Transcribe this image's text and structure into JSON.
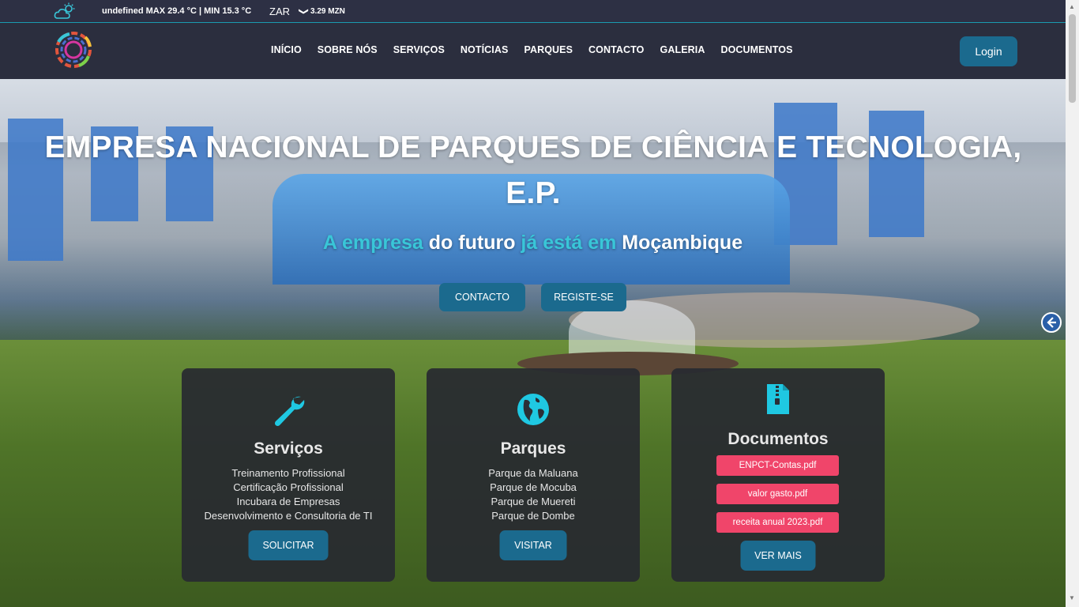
{
  "topbar": {
    "weather": "undefined MAX 29.4 °C | MIN 15.3 °C",
    "currency_code": "ZAR",
    "currency_chevron": "❯",
    "currency_rate": "3.29 MZN",
    "weather_icon": "cloud-sun-icon"
  },
  "nav": {
    "items": [
      "INÍCIO",
      "SOBRE NÓS",
      "SERVIÇOS",
      "NOTÍCIAS",
      "PARQUES",
      "CONTACTO",
      "GALERIA",
      "DOCUMENTOS"
    ],
    "login": "Login"
  },
  "hero": {
    "title": "EMPRESA NACIONAL DE PARQUES DE CIÊNCIA E TECNOLOGIA, E.P.",
    "tagline": [
      "A empresa",
      "do futuro",
      "já está em",
      "Moçambique"
    ],
    "buttons": [
      "CONTACTO",
      "REGISTE-SE"
    ]
  },
  "cards": {
    "servicos": {
      "title": "Serviços",
      "icon": "wrench-icon",
      "items": [
        "Treinamento Profissional",
        "Certificação Profissional",
        "Incubara de Empresas",
        "Desenvolvimento e Consultoria de TI"
      ],
      "button": "SOLICITAR"
    },
    "parques": {
      "title": "Parques",
      "icon": "globe-icon",
      "items": [
        "Parque da Maluana",
        "Parque de Mocuba",
        "Parque de Muereti",
        "Parque de Dombe"
      ],
      "button": "VISITAR"
    },
    "documentos": {
      "title": "Documentos",
      "icon": "file-zip-icon",
      "files": [
        "ENPCT-Contas.pdf",
        "valor gasto.pdf",
        "receita anual 2023.pdf"
      ],
      "button": "VER MAIS"
    }
  },
  "colors": {
    "accent": "#1b6a8e",
    "cyan": "#39c6d8",
    "doc_pink": "#f0456a",
    "nav_bg": "#2b2e3e"
  }
}
